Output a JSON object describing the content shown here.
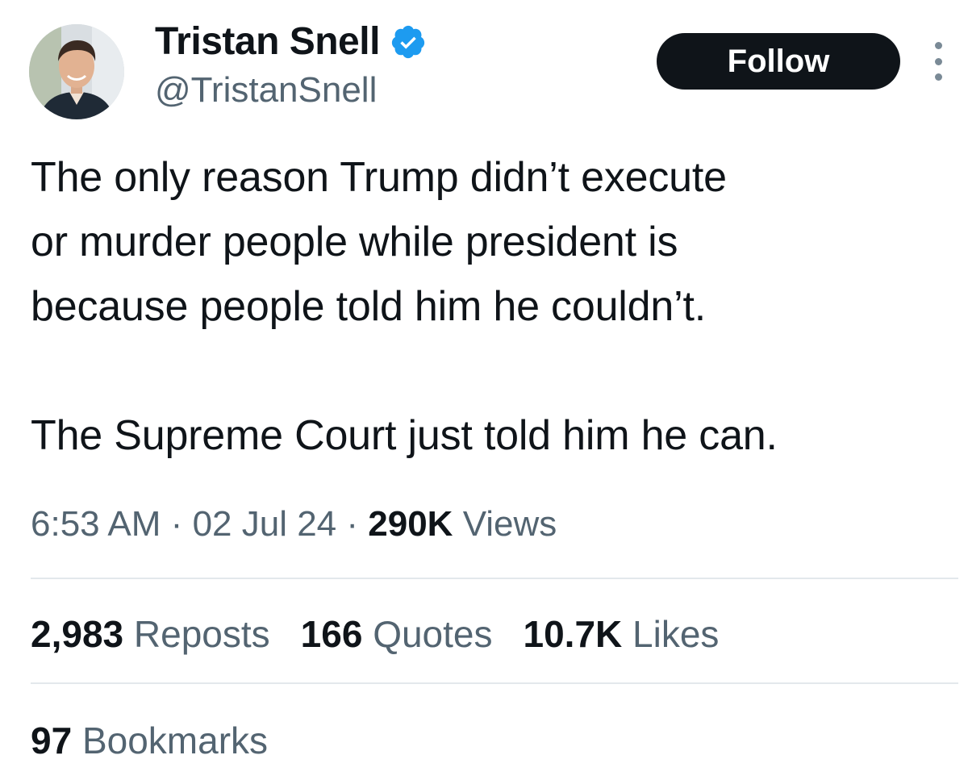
{
  "author": {
    "display_name": "Tristan Snell",
    "handle": "@TristanSnell",
    "verified_icon": "verified-badge-icon",
    "verified_color": "#1d9bf0"
  },
  "follow_button": {
    "label": "Follow",
    "background": "#0f1419"
  },
  "more_icon": "more-options-icon",
  "tweet": {
    "paragraphs": [
      "The only reason Trump didn’t execute\nor murder people while president is\nbecause people told him he couldn’t.",
      "The Supreme Court just told him he can."
    ]
  },
  "meta": {
    "time": "6:53 AM",
    "separator": "·",
    "date": "02 Jul 24",
    "views_count": "290K",
    "views_label": "Views"
  },
  "stats": {
    "reposts_count": "2,983",
    "reposts_label": "Reposts",
    "quotes_count": "166",
    "quotes_label": "Quotes",
    "likes_count": "10.7K",
    "likes_label": "Likes",
    "bookmarks_count": "97",
    "bookmarks_label": "Bookmarks"
  },
  "colors": {
    "text_primary": "#0f1419",
    "text_secondary": "#536471",
    "divider": "#e3e8ec"
  }
}
